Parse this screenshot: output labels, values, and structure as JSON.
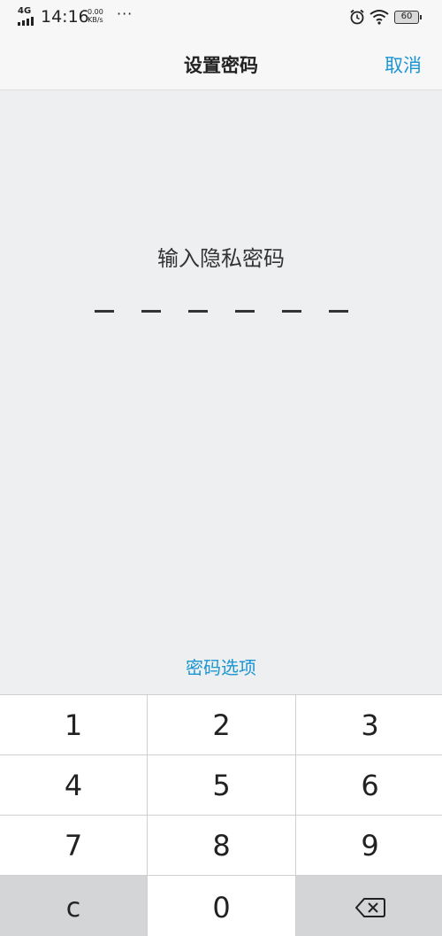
{
  "status_bar": {
    "network": "4G",
    "time": "14:16",
    "speed_value": "0.00",
    "speed_unit": "KB/s",
    "more": "···",
    "battery": "60"
  },
  "nav": {
    "title": "设置密码",
    "cancel": "取消"
  },
  "prompt": "输入隐私密码",
  "pin_length": 6,
  "options_link": "密码选项",
  "keypad": {
    "keys": [
      "1",
      "2",
      "3",
      "4",
      "5",
      "6",
      "7",
      "8",
      "9"
    ],
    "clear": "c",
    "zero": "0"
  },
  "colors": {
    "accent": "#1b96d3",
    "background": "#eeeff0",
    "function_key": "#d4d5d7"
  }
}
